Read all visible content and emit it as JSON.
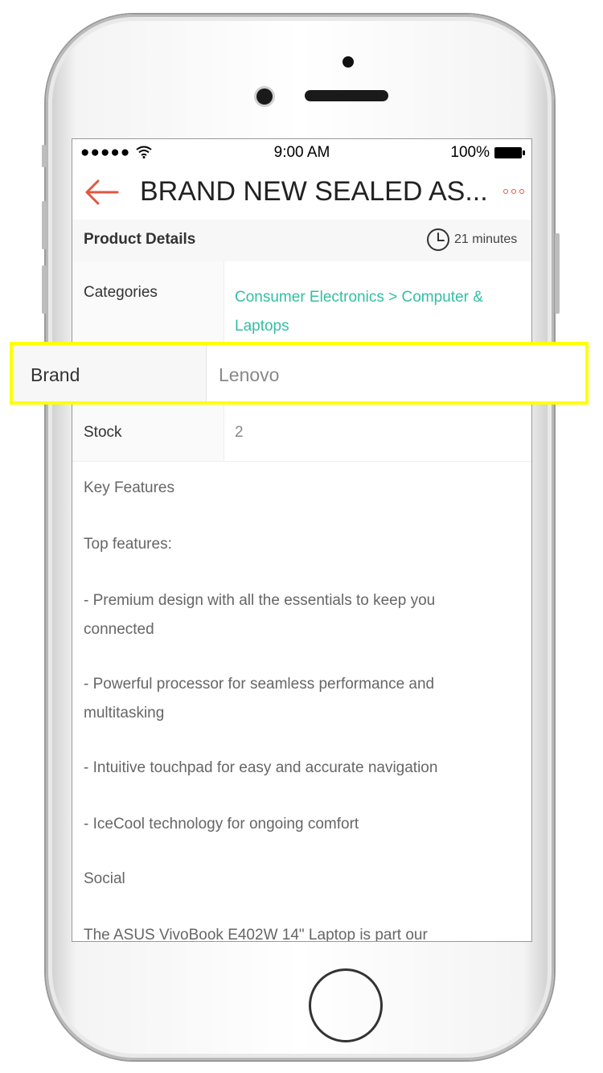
{
  "status_bar": {
    "signal": "●●●●●",
    "wifi_icon": "wifi-icon",
    "time": "9:00 AM",
    "battery": "100%"
  },
  "nav": {
    "title": "BRAND NEW SEALED AS...",
    "back_icon": "arrow-left-icon",
    "more_icon": "more-icon",
    "accent_color": "#e0573f"
  },
  "details": {
    "title": "Product Details",
    "timestamp": "21 minutes"
  },
  "rows": {
    "categories": {
      "label": "Categories",
      "line1": "Consumer Electronics > Computer &",
      "line2": "Laptops",
      "link_color": "#33bfa4"
    },
    "brand": {
      "label": "Brand",
      "value": "Lenovo"
    },
    "stock": {
      "label": "Stock",
      "value": "2"
    }
  },
  "description": [
    "Key Features",
    "Top features:",
    "- Premium design with all the essentials to keep you",
    "connected",
    "- Powerful processor for seamless performance and",
    "multitasking",
    "- Intuitive touchpad for easy and accurate navigation",
    "- IceCool technology for ongoing comfort",
    "Social",
    "The ASUS VivoBook E402W 14\" Laptop is part our"
  ],
  "highlight_color": "#ffff00"
}
